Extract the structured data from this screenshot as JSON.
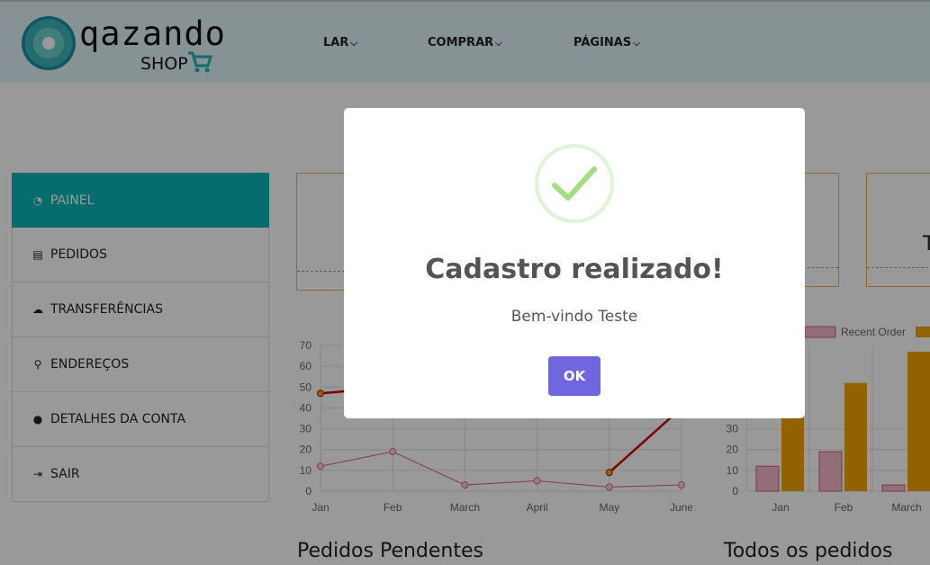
{
  "brand": {
    "word": "qazando",
    "sub": "SHOP"
  },
  "nav": [
    {
      "label": "LAR"
    },
    {
      "label": "COMPRAR"
    },
    {
      "label": "PÁGINAS"
    }
  ],
  "sidebar": {
    "items": [
      {
        "label": "PAINEL",
        "icon": "dashboard-icon",
        "active": true
      },
      {
        "label": "PEDIDOS",
        "icon": "cart-icon"
      },
      {
        "label": "TRANSFERÊNCIAS",
        "icon": "cloud-download-icon"
      },
      {
        "label": "ENDEREÇOS",
        "icon": "map-marker-icon"
      },
      {
        "label": "DETALHES DA CONTA",
        "icon": "user-icon"
      },
      {
        "label": "SAIR",
        "icon": "sign-out-icon"
      }
    ]
  },
  "cards": {
    "partial_letter": "T"
  },
  "chart_data": [
    {
      "type": "line",
      "categories": [
        "Jan",
        "Feb",
        "March",
        "April",
        "May",
        "June"
      ],
      "ylim": [
        0,
        70
      ],
      "yticks": [
        0,
        10,
        20,
        30,
        40,
        50,
        60,
        70
      ],
      "series": [
        {
          "values": [
            47,
            50,
            null,
            null,
            9,
            40
          ],
          "color": "#cc0000"
        },
        {
          "values": [
            12,
            19,
            3,
            5,
            2,
            3
          ],
          "color": "#e06080"
        }
      ],
      "grid": true
    },
    {
      "type": "bar",
      "categories": [
        "Jan",
        "Feb",
        "March"
      ],
      "yticks": [
        0,
        10,
        20,
        30
      ],
      "ylim": [
        0,
        70
      ],
      "series": [
        {
          "name": "Recent Order",
          "values": [
            12,
            19,
            3
          ],
          "color": "#f4b8c8"
        },
        {
          "name": "",
          "values": [
            37,
            52,
            67
          ],
          "color": "#f0a500"
        }
      ],
      "legend": "top",
      "grid": true
    }
  ],
  "sections": {
    "pending": "Pedidos Pendentes",
    "all": "Todos os pedidos"
  },
  "modal": {
    "title": "Cadastro realizado!",
    "text": "Bem-vindo Teste",
    "ok": "OK"
  },
  "colors": {
    "accent": "#0ab4b8",
    "button": "#7066e0",
    "success": "#a5dc86"
  }
}
